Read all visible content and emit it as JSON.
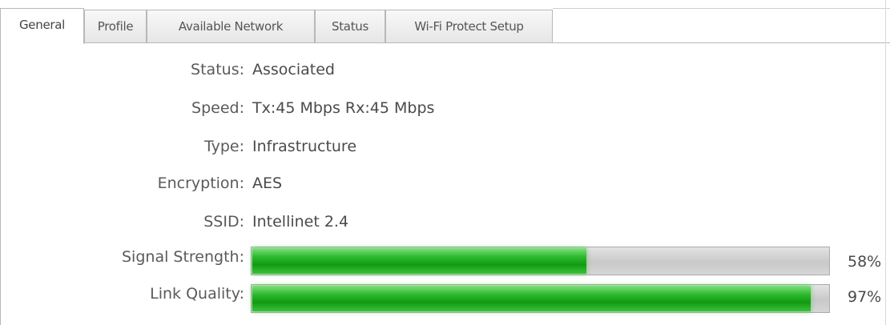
{
  "tabs": [
    {
      "label": "General",
      "active": true
    },
    {
      "label": "Profile",
      "active": false
    },
    {
      "label": "Available Network",
      "active": false
    },
    {
      "label": "Status",
      "active": false
    },
    {
      "label": "Wi-Fi Protect Setup",
      "active": false
    }
  ],
  "general": {
    "status": {
      "label": "Status:",
      "value": "Associated"
    },
    "speed": {
      "label": "Speed:",
      "value": "Tx:45 Mbps Rx:45 Mbps"
    },
    "type": {
      "label": "Type:",
      "value": "Infrastructure"
    },
    "encryption": {
      "label": "Encryption:",
      "value": "AES"
    },
    "ssid": {
      "label": "SSID:",
      "value": "Intellinet 2.4"
    },
    "signal_strength": {
      "label": "Signal Strength:",
      "percent_text": "58%",
      "level": 0.58
    },
    "link_quality": {
      "label": "Link Quality:",
      "percent_text": "97%",
      "level": 0.97
    }
  },
  "colors": {
    "bar_fill": "#2bb82b",
    "bar_track": "#c9c9c9"
  }
}
